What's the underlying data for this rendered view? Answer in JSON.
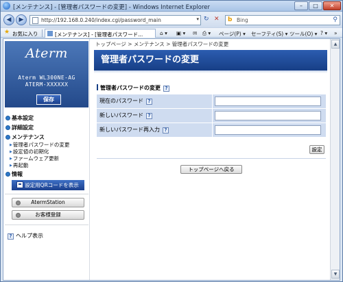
{
  "window": {
    "title": "[メンテナンス] - [管理者パスワードの変更] - Windows Internet Explorer",
    "minimize": "–",
    "maximize": "□",
    "close": "✕"
  },
  "addressbar": {
    "back": "◀",
    "forward": "▶",
    "url": "http://192.168.0.240/index.cgi/password_main",
    "dropdown": "▾",
    "refresh": "↻",
    "stop": "✕",
    "search_placeholder": "Bing",
    "search_icon": "⚲"
  },
  "favbar": {
    "favorites_label": "お気に入り",
    "tab_title": "[メンテナンス] - [管理者パスワード...",
    "commands": {
      "home": "⌂ ▾",
      "feeds": "▣ ▾",
      "mail": "✉",
      "print": "⎙ ▾",
      "page": "ページ(P) ▾",
      "safety": "セーフティ(S) ▾",
      "tools": "ツール(O) ▾",
      "help": "? ▾",
      "more": "»"
    }
  },
  "sidebar": {
    "logo": "Aterm",
    "model": "Aterm WL300NE-AG",
    "serial": "ATERM-XXXXXX",
    "save_label": "保存",
    "menu": {
      "basic": "基本設定",
      "advanced": "詳細設定",
      "maintenance": "メンテナンス",
      "maintenance_items": [
        "管理者パスワードの変更",
        "設定値の初期化",
        "ファームウェア更新",
        "再起動"
      ],
      "info": "情報"
    },
    "qr_label": "設定用QRコードを表示",
    "aterm_station_label": "AtermStation",
    "customer_reg_label": "お客様登録",
    "help_label": "ヘルプ表示"
  },
  "main": {
    "breadcrumb": "トップページ > メンテナンス > 管理者パスワードの変更",
    "title": "管理者パスワードの変更",
    "section_title": "管理者パスワードの変更",
    "help_mark": "?",
    "fields": [
      {
        "label": "現在のパスワード",
        "value": ""
      },
      {
        "label": "新しいパスワード",
        "value": ""
      },
      {
        "label": "新しいパスワード再入力",
        "value": ""
      }
    ],
    "set_label": "設定",
    "back_to_top_label": "トップページへ戻る"
  },
  "colors": {
    "header_blue": "#1f4b98",
    "label_bg": "#cfdcf0",
    "bullet_blue": "#2e78c8"
  }
}
